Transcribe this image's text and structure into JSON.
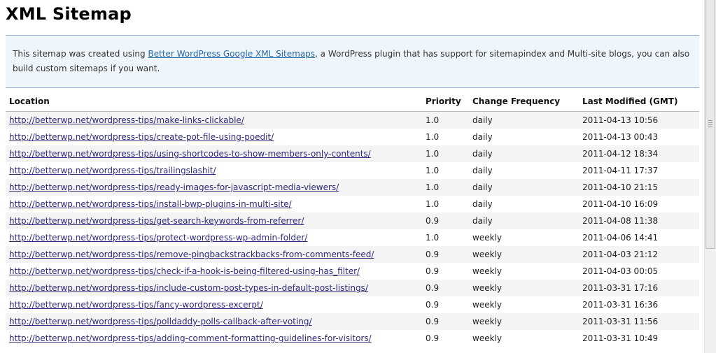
{
  "page": {
    "title": "XML Sitemap"
  },
  "intro": {
    "before_link": "This sitemap was created using ",
    "link_text": "Better WordPress Google XML Sitemaps",
    "after_link": ", a WordPress plugin that has support for sitemapindex and Multi-site blogs, you can also build custom sitemaps if you want."
  },
  "table": {
    "headers": {
      "location": "Location",
      "priority": "Priority",
      "frequency": "Change Frequency",
      "modified": "Last Modified (GMT)"
    },
    "rows": [
      {
        "url": "http://betterwp.net/wordpress-tips/make-links-clickable/",
        "priority": "1.0",
        "frequency": "daily",
        "modified": "2011-04-13 10:56"
      },
      {
        "url": "http://betterwp.net/wordpress-tips/create-pot-file-using-poedit/",
        "priority": "1.0",
        "frequency": "daily",
        "modified": "2011-04-13 00:43"
      },
      {
        "url": "http://betterwp.net/wordpress-tips/using-shortcodes-to-show-members-only-contents/",
        "priority": "1.0",
        "frequency": "daily",
        "modified": "2011-04-12 18:34"
      },
      {
        "url": "http://betterwp.net/wordpress-tips/trailingslashit/",
        "priority": "1.0",
        "frequency": "daily",
        "modified": "2011-04-11 17:37"
      },
      {
        "url": "http://betterwp.net/wordpress-tips/ready-images-for-javascript-media-viewers/",
        "priority": "1.0",
        "frequency": "daily",
        "modified": "2011-04-10 21:15"
      },
      {
        "url": "http://betterwp.net/wordpress-tips/install-bwp-plugins-in-multi-site/",
        "priority": "1.0",
        "frequency": "daily",
        "modified": "2011-04-10 16:09"
      },
      {
        "url": "http://betterwp.net/wordpress-tips/get-search-keywords-from-referrer/",
        "priority": "0.9",
        "frequency": "daily",
        "modified": "2011-04-08 11:38"
      },
      {
        "url": "http://betterwp.net/wordpress-tips/protect-wordpress-wp-admin-folder/",
        "priority": "1.0",
        "frequency": "weekly",
        "modified": "2011-04-06 14:41"
      },
      {
        "url": "http://betterwp.net/wordpress-tips/remove-pingbackstrackbacks-from-comments-feed/",
        "priority": "0.9",
        "frequency": "weekly",
        "modified": "2011-04-03 21:12"
      },
      {
        "url": "http://betterwp.net/wordpress-tips/check-if-a-hook-is-being-filtered-using-has_filter/",
        "priority": "0.9",
        "frequency": "weekly",
        "modified": "2011-04-03 00:05"
      },
      {
        "url": "http://betterwp.net/wordpress-tips/include-custom-post-types-in-default-post-listings/",
        "priority": "0.9",
        "frequency": "weekly",
        "modified": "2011-03-31 17:16"
      },
      {
        "url": "http://betterwp.net/wordpress-tips/fancy-wordpress-excerpt/",
        "priority": "0.9",
        "frequency": "weekly",
        "modified": "2011-03-31 16:36"
      },
      {
        "url": "http://betterwp.net/wordpress-tips/polldaddy-polls-callback-after-voting/",
        "priority": "0.9",
        "frequency": "weekly",
        "modified": "2011-03-31 11:56"
      },
      {
        "url": "http://betterwp.net/wordpress-tips/adding-comment-formatting-guidelines-for-visitors/",
        "priority": "0.9",
        "frequency": "weekly",
        "modified": "2011-03-31 10:49"
      }
    ]
  },
  "colors": {
    "intro_background": "#eef5fb",
    "intro_border": "#8cb3cb",
    "link": "#2d2a7a",
    "intro_link": "#2a67a6",
    "row_stripe": "#f4f4f4"
  }
}
